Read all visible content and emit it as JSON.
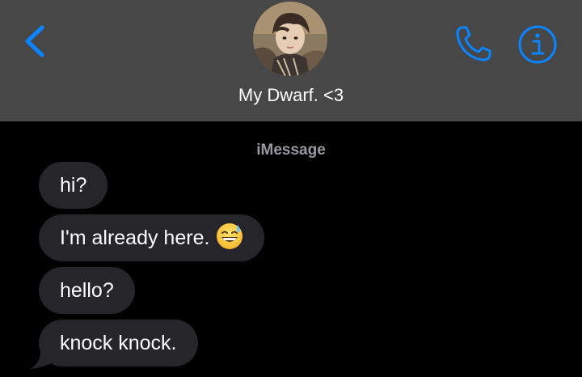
{
  "header": {
    "back_icon": "chevron-left-icon",
    "contact_name": "My Dwarf. <3",
    "call_icon": "phone-icon",
    "info_icon": "info-icon",
    "accent_color": "#0a84ff",
    "background_color": "#474747"
  },
  "conversation": {
    "service_label": "iMessage",
    "messages": [
      {
        "text": "hi?",
        "emoji": ""
      },
      {
        "text": "I'm already here.",
        "emoji": "grinning-face-with-sweat-icon"
      },
      {
        "text": "hello?",
        "emoji": ""
      },
      {
        "text": "knock knock.",
        "emoji": ""
      }
    ],
    "bubble_color": "#26252a"
  }
}
